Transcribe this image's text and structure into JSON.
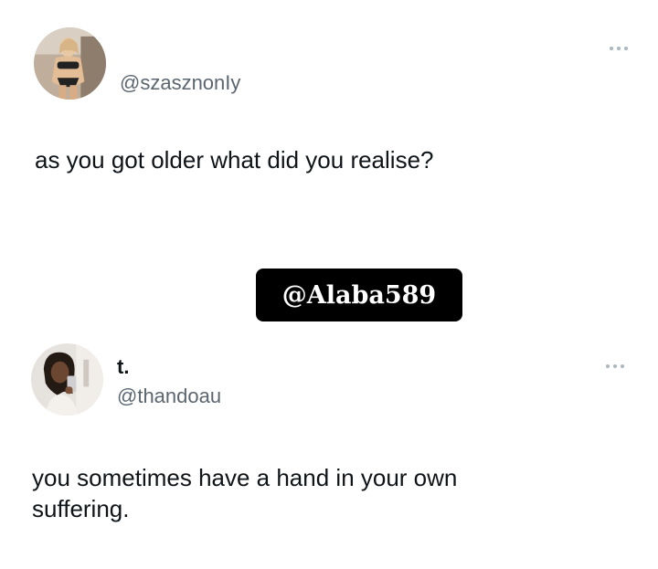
{
  "tweets": [
    {
      "display_name": "",
      "handle": "@szasznonIy",
      "text": "as you got older what did you realise?",
      "avatar": "avatar-photo",
      "more_icon": "more-options-icon"
    },
    {
      "display_name": "t.",
      "handle": "@thandoau",
      "text": "you sometimes have a hand in your own suffering.",
      "avatar": "avatar-photo",
      "more_icon": "more-options-icon"
    }
  ],
  "watermark": {
    "text": "@Alaba589"
  },
  "colors": {
    "text": "#0f1419",
    "handle": "#5b6670",
    "dots": "#aab8c2",
    "watermark_bg": "#000000",
    "watermark_text": "#ffffff"
  }
}
